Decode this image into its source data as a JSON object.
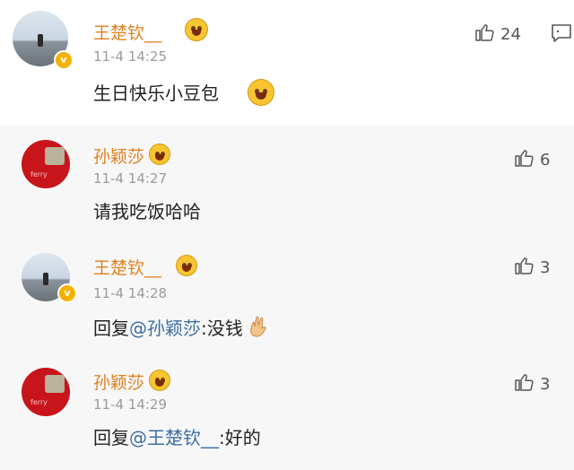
{
  "comments": [
    {
      "name": "王楚钦__",
      "time": "11-4 14:25",
      "content": "生日快乐小豆包",
      "likes": "24"
    },
    {
      "name": "孙颖莎",
      "time": "11-4 14:27",
      "content": "请我吃饭哈哈",
      "likes": "6"
    },
    {
      "name": "王楚钦__",
      "time": "11-4 14:28",
      "prefix": "回复",
      "mention": "@孙颖莎",
      "content": ":没钱",
      "likes": "3"
    },
    {
      "name": "孙颖莎",
      "time": "11-4 14:29",
      "prefix": "回复",
      "mention": "@王楚钦__",
      "content": ":好的",
      "likes": "3"
    }
  ],
  "colors": {
    "name": "#e0801e",
    "mention": "#3a6ea5",
    "badge": "#f5b200"
  },
  "icons": [
    "thumbs-up-icon",
    "comment-icon",
    "verified-badge-icon",
    "laughing-emoji-icon",
    "hand-gesture-emoji"
  ]
}
